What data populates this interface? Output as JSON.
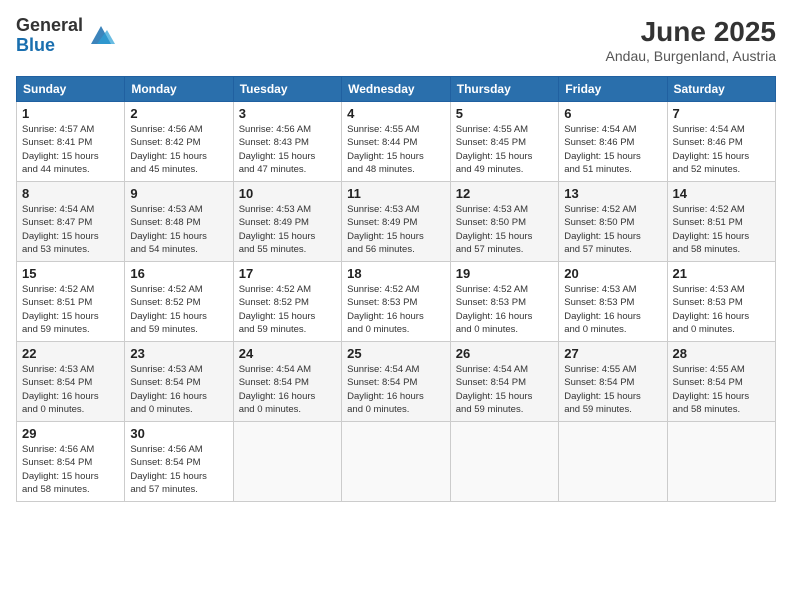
{
  "logo": {
    "general": "General",
    "blue": "Blue"
  },
  "title": "June 2025",
  "location": "Andau, Burgenland, Austria",
  "headers": [
    "Sunday",
    "Monday",
    "Tuesday",
    "Wednesday",
    "Thursday",
    "Friday",
    "Saturday"
  ],
  "weeks": [
    [
      {
        "day": "1",
        "info": "Sunrise: 4:57 AM\nSunset: 8:41 PM\nDaylight: 15 hours\nand 44 minutes."
      },
      {
        "day": "2",
        "info": "Sunrise: 4:56 AM\nSunset: 8:42 PM\nDaylight: 15 hours\nand 45 minutes."
      },
      {
        "day": "3",
        "info": "Sunrise: 4:56 AM\nSunset: 8:43 PM\nDaylight: 15 hours\nand 47 minutes."
      },
      {
        "day": "4",
        "info": "Sunrise: 4:55 AM\nSunset: 8:44 PM\nDaylight: 15 hours\nand 48 minutes."
      },
      {
        "day": "5",
        "info": "Sunrise: 4:55 AM\nSunset: 8:45 PM\nDaylight: 15 hours\nand 49 minutes."
      },
      {
        "day": "6",
        "info": "Sunrise: 4:54 AM\nSunset: 8:46 PM\nDaylight: 15 hours\nand 51 minutes."
      },
      {
        "day": "7",
        "info": "Sunrise: 4:54 AM\nSunset: 8:46 PM\nDaylight: 15 hours\nand 52 minutes."
      }
    ],
    [
      {
        "day": "8",
        "info": "Sunrise: 4:54 AM\nSunset: 8:47 PM\nDaylight: 15 hours\nand 53 minutes."
      },
      {
        "day": "9",
        "info": "Sunrise: 4:53 AM\nSunset: 8:48 PM\nDaylight: 15 hours\nand 54 minutes."
      },
      {
        "day": "10",
        "info": "Sunrise: 4:53 AM\nSunset: 8:49 PM\nDaylight: 15 hours\nand 55 minutes."
      },
      {
        "day": "11",
        "info": "Sunrise: 4:53 AM\nSunset: 8:49 PM\nDaylight: 15 hours\nand 56 minutes."
      },
      {
        "day": "12",
        "info": "Sunrise: 4:53 AM\nSunset: 8:50 PM\nDaylight: 15 hours\nand 57 minutes."
      },
      {
        "day": "13",
        "info": "Sunrise: 4:52 AM\nSunset: 8:50 PM\nDaylight: 15 hours\nand 57 minutes."
      },
      {
        "day": "14",
        "info": "Sunrise: 4:52 AM\nSunset: 8:51 PM\nDaylight: 15 hours\nand 58 minutes."
      }
    ],
    [
      {
        "day": "15",
        "info": "Sunrise: 4:52 AM\nSunset: 8:51 PM\nDaylight: 15 hours\nand 59 minutes."
      },
      {
        "day": "16",
        "info": "Sunrise: 4:52 AM\nSunset: 8:52 PM\nDaylight: 15 hours\nand 59 minutes."
      },
      {
        "day": "17",
        "info": "Sunrise: 4:52 AM\nSunset: 8:52 PM\nDaylight: 15 hours\nand 59 minutes."
      },
      {
        "day": "18",
        "info": "Sunrise: 4:52 AM\nSunset: 8:53 PM\nDaylight: 16 hours\nand 0 minutes."
      },
      {
        "day": "19",
        "info": "Sunrise: 4:52 AM\nSunset: 8:53 PM\nDaylight: 16 hours\nand 0 minutes."
      },
      {
        "day": "20",
        "info": "Sunrise: 4:53 AM\nSunset: 8:53 PM\nDaylight: 16 hours\nand 0 minutes."
      },
      {
        "day": "21",
        "info": "Sunrise: 4:53 AM\nSunset: 8:53 PM\nDaylight: 16 hours\nand 0 minutes."
      }
    ],
    [
      {
        "day": "22",
        "info": "Sunrise: 4:53 AM\nSunset: 8:54 PM\nDaylight: 16 hours\nand 0 minutes."
      },
      {
        "day": "23",
        "info": "Sunrise: 4:53 AM\nSunset: 8:54 PM\nDaylight: 16 hours\nand 0 minutes."
      },
      {
        "day": "24",
        "info": "Sunrise: 4:54 AM\nSunset: 8:54 PM\nDaylight: 16 hours\nand 0 minutes."
      },
      {
        "day": "25",
        "info": "Sunrise: 4:54 AM\nSunset: 8:54 PM\nDaylight: 16 hours\nand 0 minutes."
      },
      {
        "day": "26",
        "info": "Sunrise: 4:54 AM\nSunset: 8:54 PM\nDaylight: 15 hours\nand 59 minutes."
      },
      {
        "day": "27",
        "info": "Sunrise: 4:55 AM\nSunset: 8:54 PM\nDaylight: 15 hours\nand 59 minutes."
      },
      {
        "day": "28",
        "info": "Sunrise: 4:55 AM\nSunset: 8:54 PM\nDaylight: 15 hours\nand 58 minutes."
      }
    ],
    [
      {
        "day": "29",
        "info": "Sunrise: 4:56 AM\nSunset: 8:54 PM\nDaylight: 15 hours\nand 58 minutes."
      },
      {
        "day": "30",
        "info": "Sunrise: 4:56 AM\nSunset: 8:54 PM\nDaylight: 15 hours\nand 57 minutes."
      },
      {
        "day": "",
        "info": ""
      },
      {
        "day": "",
        "info": ""
      },
      {
        "day": "",
        "info": ""
      },
      {
        "day": "",
        "info": ""
      },
      {
        "day": "",
        "info": ""
      }
    ]
  ]
}
